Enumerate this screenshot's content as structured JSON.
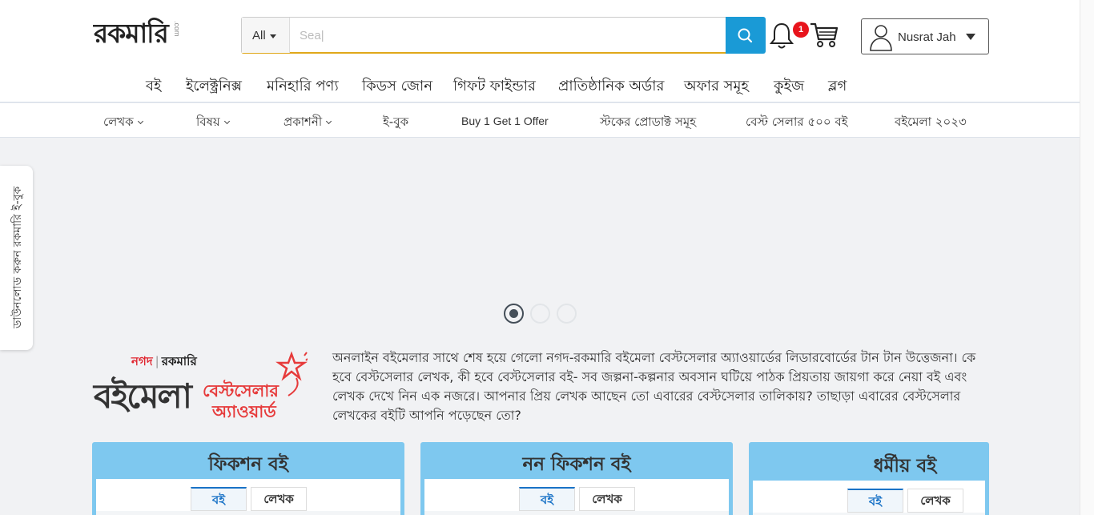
{
  "header": {
    "logo_text": "রকমারি",
    "logo_suffix": ".com",
    "search": {
      "category": "All",
      "placeholder": "",
      "value": "Sea|"
    },
    "notification_count": "1",
    "user_name": "Nusrat Jah"
  },
  "main_nav": [
    "বই",
    "ইলেক্ট্রনিক্স",
    "মনিহারি পণ্য",
    "কিডস জোন",
    "গিফট ফাইন্ডার",
    "প্রাতিষ্ঠানিক অর্ডার",
    "অফার সমূহ",
    "কুইজ",
    "ব্লগ"
  ],
  "sub_nav": [
    "লেখক",
    "বিষয়",
    "প্রকাশনী",
    "ই-বুক",
    "Buy 1 Get 1 Offer",
    "স্টকের প্রোডাক্ট সমূহ",
    "বেস্ট সেলার ৫০০ বই",
    "বইমেলা ২০২৩"
  ],
  "side_tab": "ডাউনলোড করুন রকমারি ই-বুক",
  "carousel": {
    "slide_count": 3,
    "active_index": 0
  },
  "award": {
    "brand_left": "নগদ",
    "brand_right": "রকমারি",
    "title_main": "বইমেলা",
    "title_red_1": "বেস্টসেলার",
    "title_red_2": "অ্যাওয়ার্ড",
    "description": "অনলাইন বইমেলার সাথে শেষ হয়ে গেলো নগদ-রকমারি বইমেলা বেস্টসেলার অ্যাওয়ার্ডের লিডারবোর্ডের টান টান উত্তেজনা। কে হবে বেস্টসেলার লেখক, কী হবে বেস্টসেলার বই- সব জল্পনা-কল্পনার অবসান ঘটিয়ে পাঠক প্রিয়তায় জায়গা করে নেয়া বই এবং লেখক দেখে নিন এক নজরে। আপনার প্রিয় লেখক আছেন তো এবারের বেস্টসেলার তালিকায়? তাছাড়া এবারের বেস্টসেলার লেখকের বইটি আপনি পড়েছেন তো?"
  },
  "cards": [
    {
      "title": "ফিকশন বই",
      "tabs": [
        "বই",
        "লেখক"
      ]
    },
    {
      "title": "নন ফিকশন বই",
      "tabs": [
        "বই",
        "লেখক"
      ]
    },
    {
      "title": "ধর্মীয় বই",
      "tabs": [
        "বই",
        "লেখক"
      ]
    }
  ],
  "colors": {
    "accent_blue": "#1a9ad6",
    "card_blue": "#7ec8ef",
    "badge_red": "#e8141c",
    "brand_orange": "#f26b22"
  }
}
